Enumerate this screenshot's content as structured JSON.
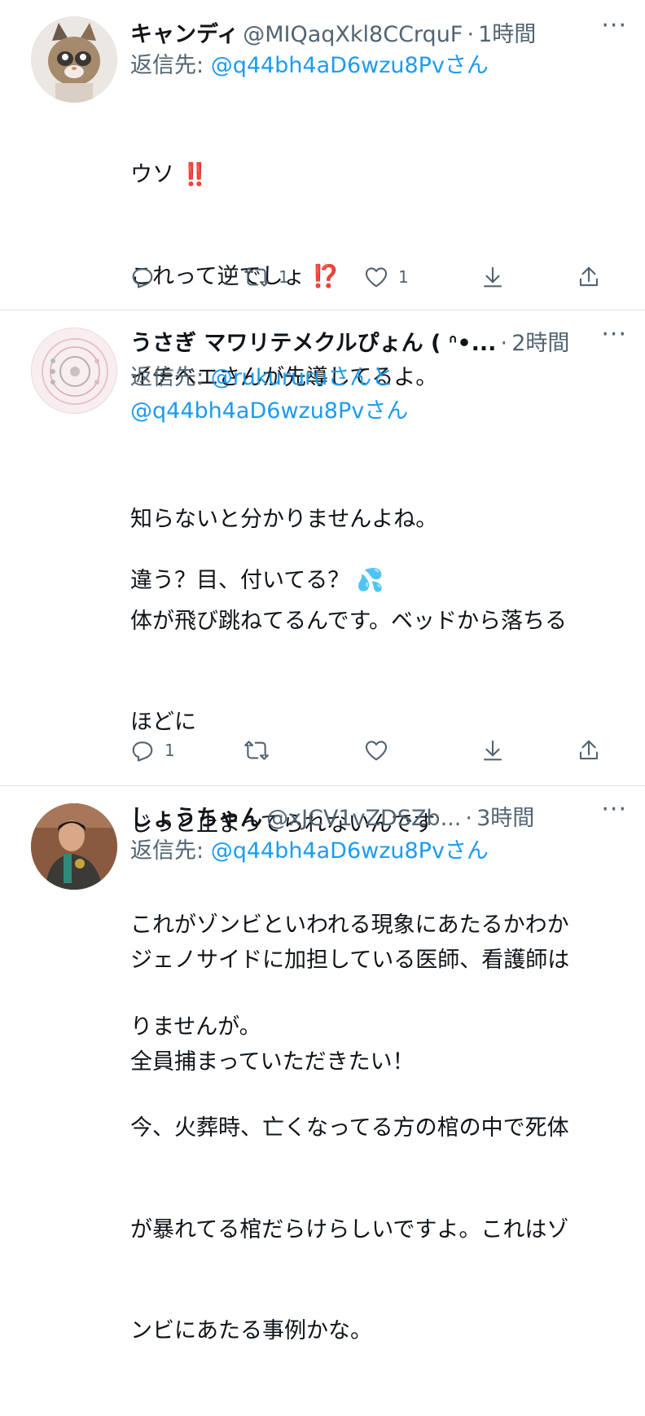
{
  "tweets": [
    {
      "name": "キャンディ",
      "handle": "@MIQaqXkl8CCrquF",
      "sep": "·",
      "time": "1時間",
      "reply_prefix": "返信先: ",
      "reply_line1": "@q44bh4aD6wzu8Pvさん",
      "reply_line2": "",
      "body_lines": [
        "ウソ ‼️",
        "これって逆でしょ ⁉️",
        "イチベエさんが先導してるよ。",
        "",
        "違う？目、付いてる？ 💦"
      ],
      "reply_count": "",
      "retweet_count": "1",
      "like_count": "1"
    },
    {
      "name": "うさぎ マワリテメクルぴょん ( ᐢ•...",
      "handle": "",
      "sep": "·",
      "time": "2時間",
      "reply_prefix": "返信先: ",
      "reply_line1": "@rukururuさんと",
      "reply_line2": "@q44bh4aD6wzu8Pvさん",
      "body_lines": [
        "知らないと分かりませんよね。",
        "体が飛び跳ねてるんです。ベッドから落ちる",
        "ほどに",
        "じっと止まってられないんです",
        "これがゾンビといわれる現象にあたるかわか",
        "りませんが。",
        "今、火葬時、亡くなってる方の棺の中で死体",
        "が暴れてる棺だらけらしいですよ。これはゾ",
        "ンビにあたる事例かな。"
      ],
      "reply_count": "1",
      "retweet_count": "",
      "like_count": ""
    },
    {
      "name": "しょうちゃん",
      "handle": "@xJCV1vZDSZb...",
      "sep": "·",
      "time": "3時間",
      "reply_prefix": "返信先: ",
      "reply_line1": "@q44bh4aD6wzu8Pvさん",
      "reply_line2": "",
      "body_lines": [
        "ジェノサイドに加担している医師、看護師は",
        "全員捕まっていただきたい！"
      ],
      "reply_count": "",
      "retweet_count": "",
      "like_count": ""
    }
  ],
  "more_label": "···",
  "icons": [
    "reply-icon",
    "retweet-icon",
    "like-icon",
    "download-icon",
    "share-icon"
  ],
  "colors": {
    "link": "#1d9bf0",
    "muted": "#536471",
    "text": "#0f1419",
    "divider": "#dcdfe2"
  }
}
